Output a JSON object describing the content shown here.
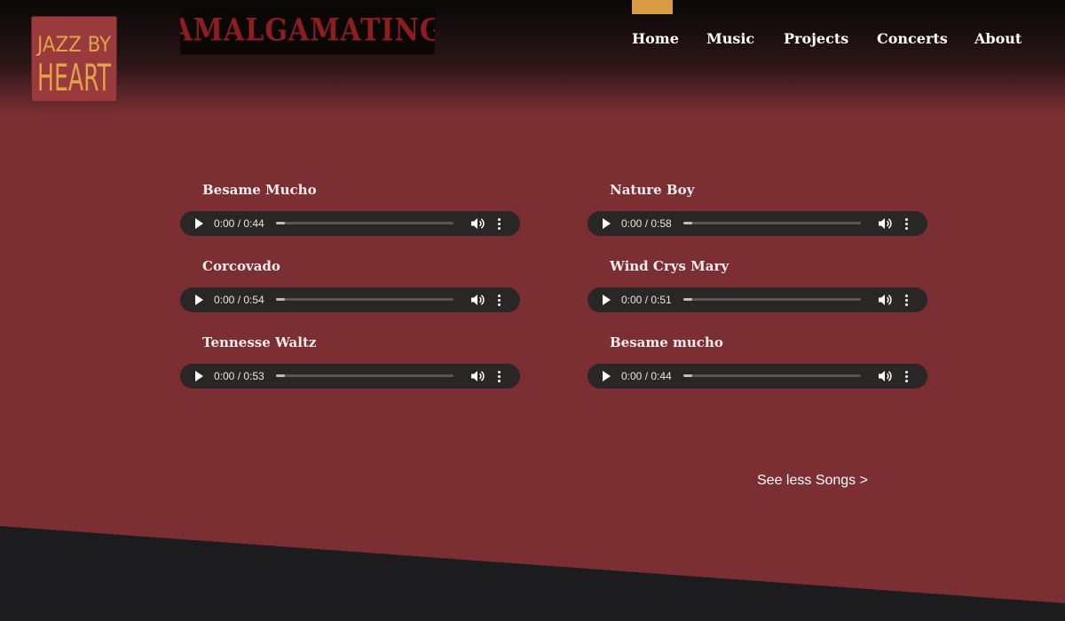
{
  "header": {
    "logo_text": [
      "JAZZ BY",
      "HEART"
    ],
    "banner_text": "AMALGAMATING"
  },
  "nav": {
    "items": [
      {
        "label": "Home",
        "active": true
      },
      {
        "label": "Music",
        "active": false
      },
      {
        "label": "Projects",
        "active": false
      },
      {
        "label": "Concerts",
        "active": false
      },
      {
        "label": "About",
        "active": false
      }
    ],
    "accent_color": "#d99a45"
  },
  "songs": [
    {
      "title": "Besame Mucho",
      "time": "0:00 / 0:44"
    },
    {
      "title": "Nature Boy",
      "time": "0:00 / 0:58"
    },
    {
      "title": "Corcovado",
      "time": "0:00 / 0:54"
    },
    {
      "title": "Wind Crys Mary",
      "time": "0:00 / 0:51"
    },
    {
      "title": "Tennesse Waltz",
      "time": "0:00 / 0:53"
    },
    {
      "title": "Besame mucho",
      "time": "0:00 / 0:44"
    }
  ],
  "see_less_label": "See less Songs >",
  "colors": {
    "background": "#7b2f33",
    "header_dark": "#0a0707",
    "player_bg": "#2a2626",
    "footer": "#1c1b1d",
    "logo_gold": "#e0a24c"
  },
  "icons": [
    "play-icon",
    "volume-icon",
    "more-vert-icon"
  ]
}
